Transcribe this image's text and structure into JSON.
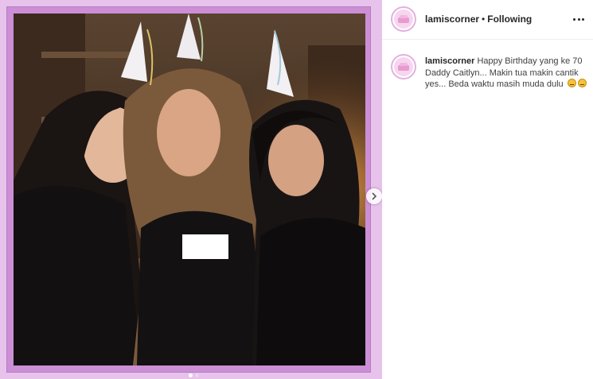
{
  "post": {
    "username": "lamiscorner",
    "separator": "•",
    "follow_status": "Following",
    "more_icon": "more-options-icon",
    "avatar_icon": "profile-avatar-icon"
  },
  "caption": {
    "username": "lamiscorner",
    "text": "Happy Birthday yang ke 70 Daddy Caitlyn... Makin tua makin cantik yes... Beda waktu masih muda dulu",
    "emojis": [
      "grimacing-face-emoji",
      "grimacing-face-emoji"
    ]
  },
  "carousel": {
    "next_icon": "chevron-right-icon",
    "slide_count": 2,
    "active_slide": 1
  },
  "colors": {
    "frame_outer": "#e7c3ec",
    "frame_inner": "#cc8fd6",
    "text": "#262626"
  }
}
